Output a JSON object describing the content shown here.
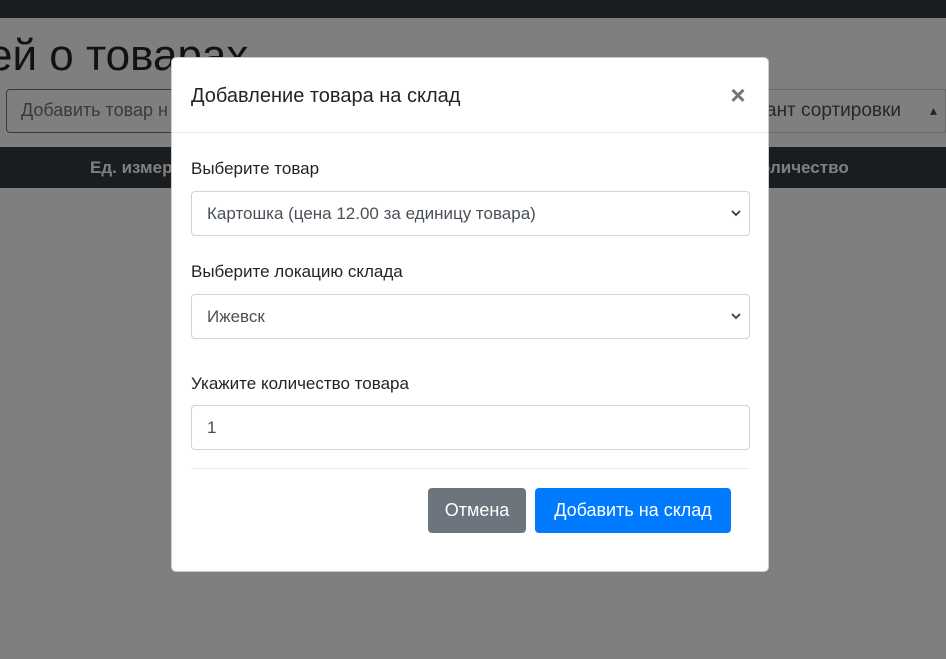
{
  "page": {
    "title_fragment": "ей о товарах",
    "add_button_fragment": "Добавить товар н",
    "sort_select_fragment": "ант сортировки",
    "table_headers": {
      "unit": "Ед. измер",
      "quantity": "оличество"
    }
  },
  "modal": {
    "title": "Добавление товара на склад",
    "close_icon": "×",
    "product_label": "Выберите товар",
    "product_selected": "Картошка (цена 12.00 за единицу товара)",
    "location_label": "Выберите локацию склада",
    "location_selected": "Ижевск",
    "quantity_label": "Укажите количество товара",
    "quantity_value": "1",
    "cancel_label": "Отмена",
    "submit_label": "Добавить на склад"
  },
  "colors": {
    "primary": "#007bff",
    "secondary": "#6c757d",
    "dark": "#343a40",
    "backdrop": "rgba(0,0,0,0.5)"
  },
  "icons": {
    "close": "close-icon",
    "select_arrow": "chevron-down-icon",
    "sort_arrow": "sort-arrows-icon"
  }
}
